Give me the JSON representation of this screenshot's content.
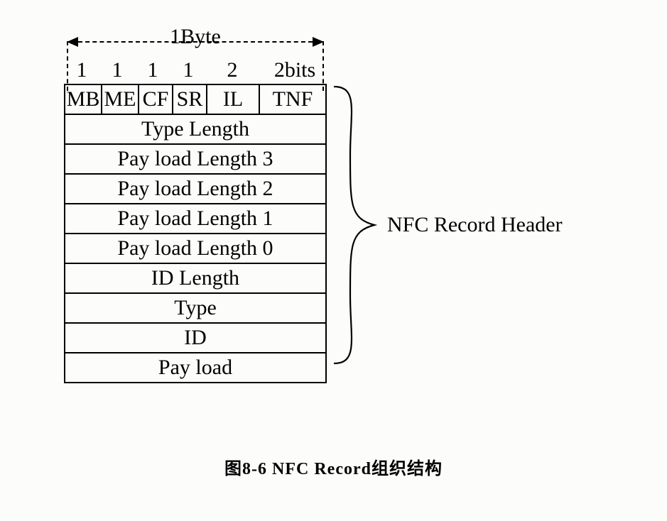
{
  "byte_label": "1Byte",
  "bit_numbers": [
    "1",
    "1",
    "1",
    "1",
    "2",
    "2bits"
  ],
  "flag_cells": [
    "MB",
    "ME",
    "CF",
    "SR",
    "IL",
    "TNF"
  ],
  "rows": [
    "Type Length",
    "Pay load Length 3",
    "Pay load Length 2",
    "Pay load Length 1",
    "Pay load Length 0",
    "ID Length",
    "Type",
    "ID",
    "Pay load"
  ],
  "brace_scope_rows": 9,
  "header_label": "NFC Record Header",
  "caption": "图8-6   NFC Record组织结构"
}
